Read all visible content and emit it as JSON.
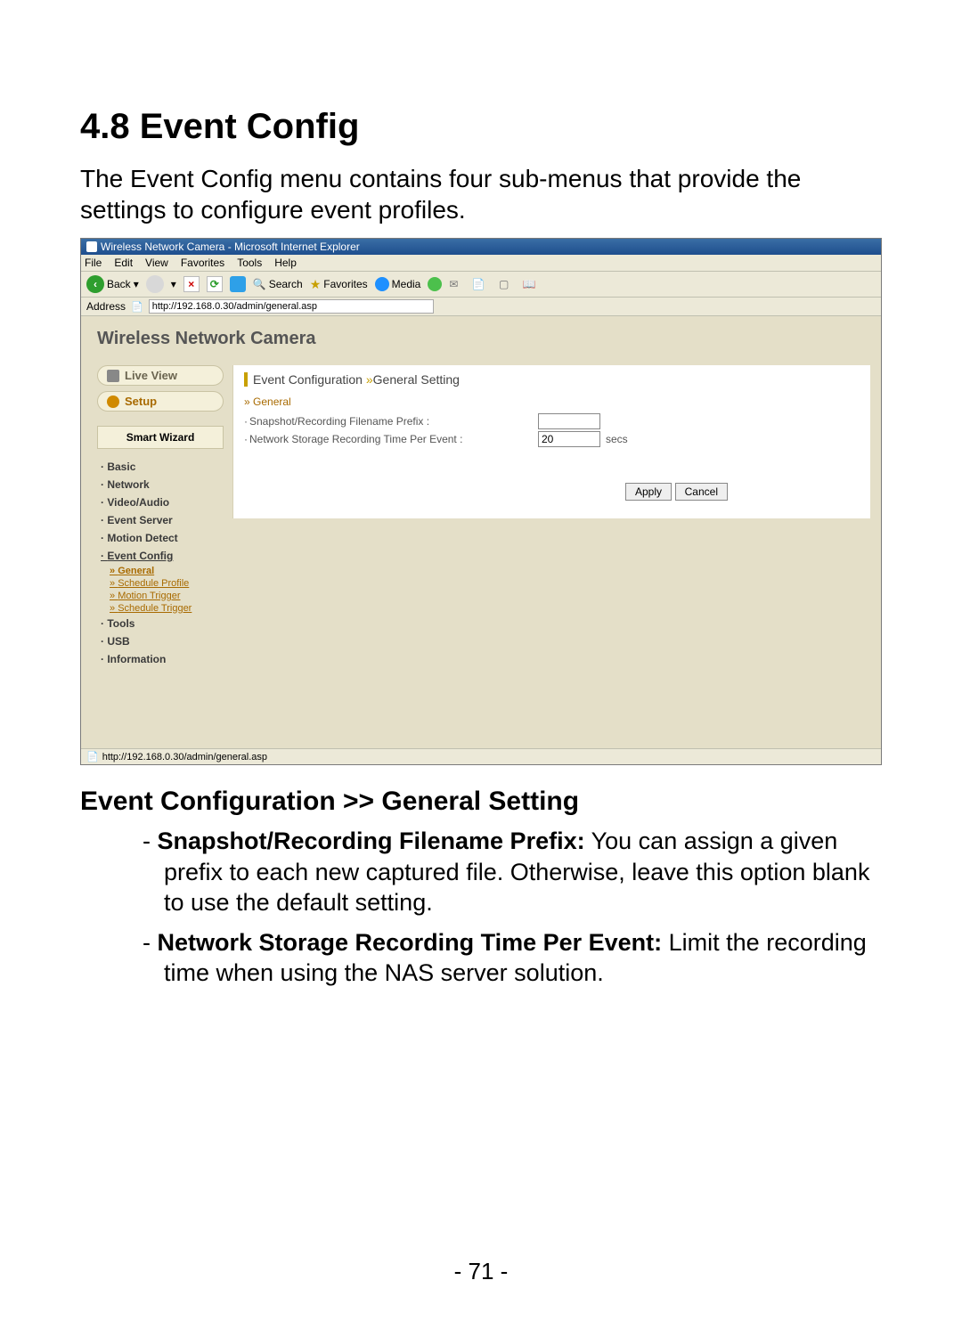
{
  "doc": {
    "section_title": "4.8  Event Config",
    "intro": "The Event Config menu contains four sub-menus that provide the settings to configure event profiles.",
    "subsection": "Event Configuration >> General Setting",
    "bullet1_bold": "Snapshot/Recording Filename Prefix:",
    "bullet1_rest": " You can assign a given prefix to each new captured file. Otherwise, leave this option blank to use the default setting.",
    "bullet2_bold": "Network Storage Recording Time Per Event:",
    "bullet2_rest": " Limit the recording time when using the NAS server solution.",
    "page_number": "- 71 -"
  },
  "ie": {
    "title": "Wireless Network Camera - Microsoft Internet Explorer",
    "menus": {
      "file": "File",
      "edit": "Edit",
      "view": "View",
      "favorites": "Favorites",
      "tools": "Tools",
      "help": "Help"
    },
    "toolbar": {
      "back": "Back",
      "search": "Search",
      "favorites": "Favorites",
      "media": "Media"
    },
    "address_label": "Address",
    "address_value": "http://192.168.0.30/admin/general.asp",
    "status": "http://192.168.0.30/admin/general.asp"
  },
  "cam": {
    "title": "Wireless Network Camera",
    "live_view": "Live View",
    "setup": "Setup",
    "smart_wizard": "Smart Wizard",
    "nav": {
      "basic": "Basic",
      "network": "Network",
      "video_audio": "Video/Audio",
      "event_server": "Event Server",
      "motion_detect": "Motion Detect",
      "event_config": "Event Config",
      "tools": "Tools",
      "usb": "USB",
      "information": "Information"
    },
    "subnav": {
      "general": "General",
      "schedule_profile": "Schedule Profile",
      "motion_trigger": "Motion Trigger",
      "schedule_trigger": "Schedule Trigger"
    },
    "crumb_a": "Event Configuration ",
    "crumb_sep": "»",
    "crumb_b": "General Setting",
    "section_label": "General",
    "row1_label": "Snapshot/Recording Filename Prefix :",
    "row1_value": "",
    "row2_label": "Network Storage Recording Time Per Event :",
    "row2_value": "20",
    "row2_unit": "secs",
    "apply": "Apply",
    "cancel": "Cancel"
  }
}
